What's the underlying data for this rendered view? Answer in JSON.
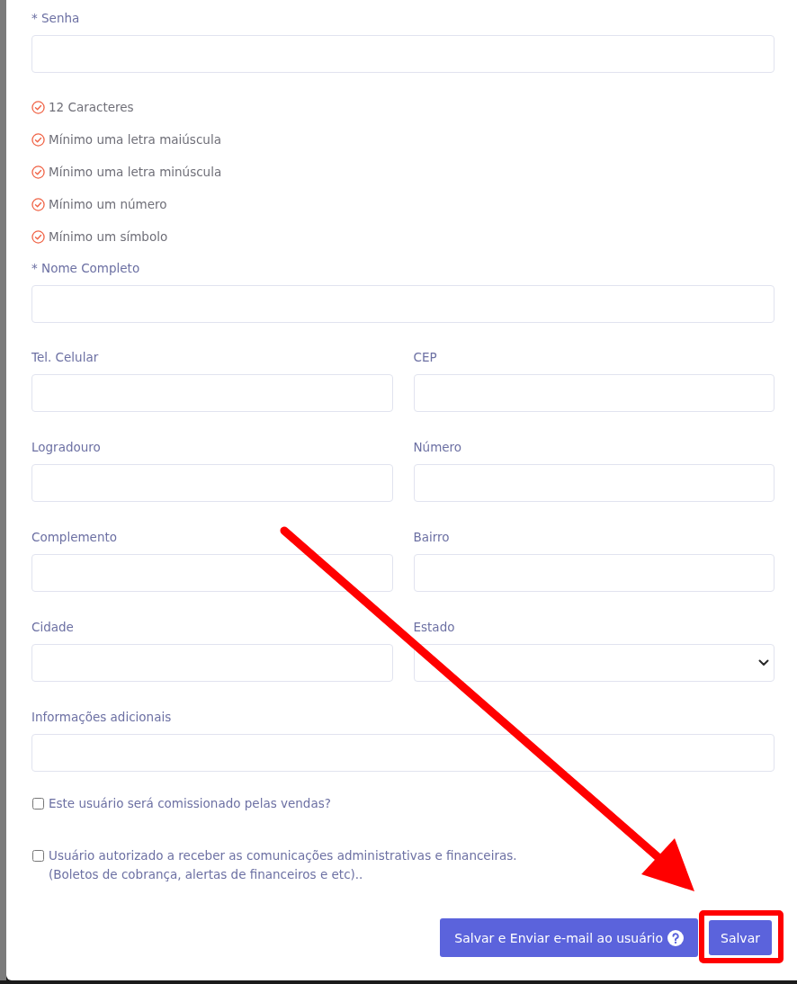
{
  "form": {
    "password_field": {
      "label": "* Senha",
      "kind": "password"
    },
    "password_rules": [
      {
        "text": "12 Caracteres",
        "met": false
      },
      {
        "text": "Mínimo uma letra maiúscula",
        "met": false
      },
      {
        "text": "Mínimo uma letra minúscula",
        "met": false
      },
      {
        "text": "Mínimo um número",
        "met": false
      },
      {
        "text": "Mínimo um símbolo",
        "met": false
      }
    ],
    "full_name_field": {
      "label": "* Nome Completo",
      "kind": "text"
    },
    "field_grid": [
      {
        "label": "Tel. Celular",
        "kind": "text"
      },
      {
        "label": "CEP",
        "kind": "text"
      },
      {
        "label": "Logradouro",
        "kind": "text"
      },
      {
        "label": "Número",
        "kind": "text"
      },
      {
        "label": "Complemento",
        "kind": "text"
      },
      {
        "label": "Bairro",
        "kind": "text"
      },
      {
        "label": "Cidade",
        "kind": "text"
      },
      {
        "label": "Estado",
        "kind": "select"
      }
    ],
    "notes_field": {
      "label": "Informações adicionais",
      "kind": "text"
    },
    "checkboxes": [
      {
        "lines": [
          "Este usuário será comissionado pelas vendas?"
        ],
        "checked": false
      },
      {
        "lines": [
          "Usuário autorizado a receber as comunicações administrativas e financeiras.",
          "(Boletos de cobrança, alertas de financeiros e etc).."
        ],
        "checked": false
      }
    ]
  },
  "buttons": [
    {
      "label": "Salvar e Enviar e-mail ao usuário",
      "kind": "send",
      "help": true,
      "highlighted": false
    },
    {
      "label": "Salvar",
      "kind": "save",
      "help": false,
      "highlighted": true
    }
  ],
  "annotation_arrow": true
}
